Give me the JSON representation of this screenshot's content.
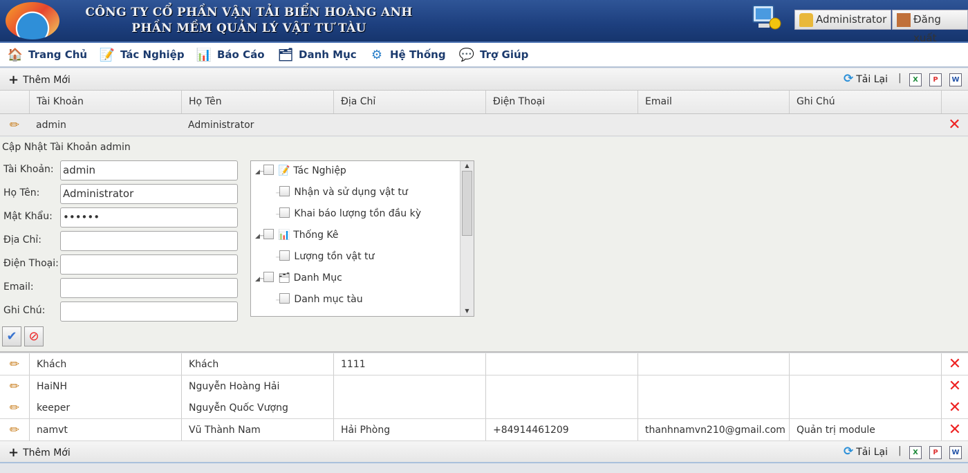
{
  "header": {
    "company": "CÔNG TY CỔ PHẦN VẬN TẢI BIỂN HOÀNG ANH",
    "app": "PHẦN MỀM QUẢN LÝ VẬT TƯ TÀU",
    "user_button": "Administrator",
    "logout_button": "Đăng xuất"
  },
  "menu": [
    {
      "label": "Trang Chủ",
      "icon": "home-icon"
    },
    {
      "label": "Tác Nghiệp",
      "icon": "edit-form-icon"
    },
    {
      "label": "Báo Cáo",
      "icon": "bar-chart-icon"
    },
    {
      "label": "Danh Mục",
      "icon": "catalog-icon"
    },
    {
      "label": "Hệ Thống",
      "icon": "gear-icon"
    },
    {
      "label": "Trợ Giúp",
      "icon": "help-chat-icon"
    }
  ],
  "toolbar": {
    "add": "Thêm Mới",
    "reload": "Tải Lại",
    "sep": "|",
    "excel": "X",
    "pdf": "P",
    "word": "W"
  },
  "columns": [
    "Tài Khoản",
    "Họ Tên",
    "Địa Chỉ",
    "Điện Thoại",
    "Email",
    "Ghi Chú"
  ],
  "selected_row": {
    "account": "admin",
    "name": "Administrator"
  },
  "form": {
    "title": "Cập Nhật Tài Khoản admin",
    "labels": [
      "Tài Khoản:",
      "Họ Tên:",
      "Mật Khẩu:",
      "Địa Chỉ:",
      "Điện Thoại:",
      "Email:",
      "Ghi Chú:"
    ],
    "values": [
      "admin",
      "Administrator",
      "••••••",
      "",
      "",
      "",
      ""
    ]
  },
  "tree": [
    {
      "label": "Tác Nghiệp",
      "level": 0,
      "icon": "edit-form-icon"
    },
    {
      "label": "Nhận và sử dụng vật tư",
      "level": 1
    },
    {
      "label": "Khai báo lượng tồn đầu kỳ",
      "level": 1
    },
    {
      "label": "Thống Kê",
      "level": 0,
      "icon": "bar-chart-icon"
    },
    {
      "label": "Lượng tồn vật tư",
      "level": 1
    },
    {
      "label": "Danh Mục",
      "level": 0,
      "icon": "catalog-icon"
    },
    {
      "label": "Danh mục tàu",
      "level": 1
    }
  ],
  "rows": [
    [
      "Khách",
      "Khách",
      "1111",
      "",
      "",
      ""
    ],
    [
      "HaiNH",
      "Nguyễn Hoàng Hải",
      "",
      "",
      "",
      ""
    ],
    [
      "keeper",
      "Nguyễn Quốc Vượng",
      "",
      "",
      "",
      ""
    ],
    [
      "namvt",
      "Vũ Thành Nam",
      "Hải Phòng",
      "+84914461209",
      "thanhnamvn210@gmail.com",
      "Quản trị module"
    ]
  ]
}
